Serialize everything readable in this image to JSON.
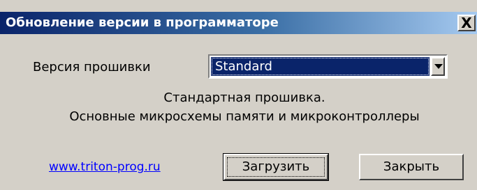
{
  "window": {
    "title": "Обновление версии в программаторе",
    "close_glyph": "X"
  },
  "form": {
    "firmware_label": "Версия прошивки",
    "firmware_selected": "Standard"
  },
  "description": {
    "line1": "Стандартная прошивка.",
    "line2": "Основные микросхемы памяти и микроконтроллеры"
  },
  "footer": {
    "link_text": "www.triton-prog.ru",
    "load_button": "Загрузить",
    "close_button": "Закрыть"
  },
  "colors": {
    "titlebar_start": "#0a246a",
    "titlebar_end": "#a6caf0",
    "face": "#d4d0c8",
    "selection": "#0a246a",
    "link": "#0000ff"
  },
  "icons": {
    "close": "close-icon",
    "dropdown": "chevron-down-icon"
  }
}
